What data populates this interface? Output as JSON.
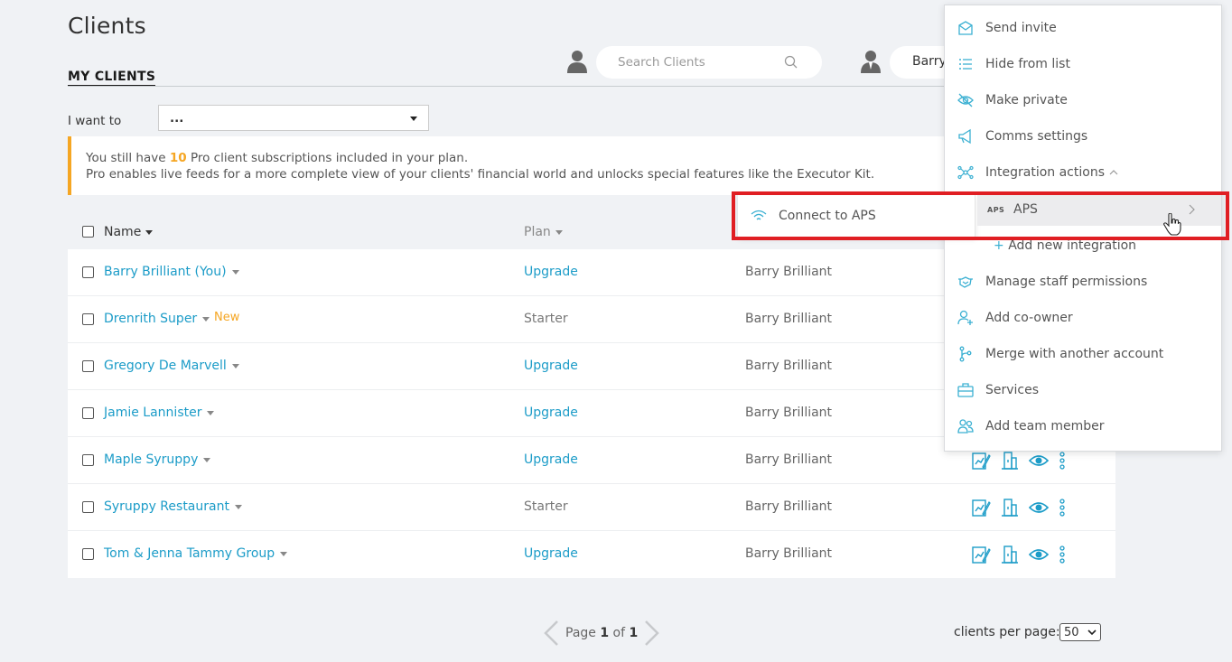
{
  "page": {
    "title": "Clients",
    "tab_active": "MY CLIENTS"
  },
  "search": {
    "placeholder": "Search Clients"
  },
  "user": {
    "name": "Barry"
  },
  "iwant": {
    "label": "I want to",
    "value": "..."
  },
  "banner": {
    "line1_prefix": "You still have ",
    "count": "10",
    "line1_suffix": " Pro client subscriptions included in your plan.",
    "line2": "Pro enables live feeds for a more complete view of your clients' financial world and unlocks special features like the Executor Kit."
  },
  "table": {
    "headers": {
      "name": "Name",
      "plan": "Plan"
    },
    "rows": [
      {
        "name": "Barry Brilliant (You)",
        "tag": "",
        "plan": "Upgrade",
        "plan_type": "upgrade",
        "owner": "Barry Brilliant"
      },
      {
        "name": "Drenrith Super",
        "tag": "New",
        "plan": "Starter",
        "plan_type": "starter",
        "owner": "Barry Brilliant"
      },
      {
        "name": "Gregory De Marvell",
        "tag": "",
        "plan": "Upgrade",
        "plan_type": "upgrade",
        "owner": "Barry Brilliant"
      },
      {
        "name": "Jamie Lannister",
        "tag": "",
        "plan": "Upgrade",
        "plan_type": "upgrade",
        "owner": "Barry Brilliant"
      },
      {
        "name": "Maple Syruppy",
        "tag": "",
        "plan": "Upgrade",
        "plan_type": "upgrade",
        "owner": "Barry Brilliant"
      },
      {
        "name": "Syruppy Restaurant",
        "tag": "",
        "plan": "Starter",
        "plan_type": "starter",
        "owner": "Barry Brilliant"
      },
      {
        "name": "Tom & Jenna Tammy Group",
        "tag": "",
        "plan": "Upgrade",
        "plan_type": "upgrade",
        "owner": "Barry Brilliant"
      }
    ]
  },
  "pagination": {
    "label_prefix": "Page ",
    "current": "1",
    "sep": " of ",
    "total": "1"
  },
  "per_page": {
    "label": "clients per page:",
    "value": "50"
  },
  "menu": {
    "items": [
      {
        "label": "Send invite",
        "icon": "envelope-icon"
      },
      {
        "label": "Hide from list",
        "icon": "list-icon"
      },
      {
        "label": "Make private",
        "icon": "eye-slash-icon"
      },
      {
        "label": "Comms settings",
        "icon": "megaphone-icon"
      },
      {
        "label": "Integration actions",
        "icon": "network-icon"
      },
      {
        "label": "Manage staff permissions",
        "icon": "handshake-icon"
      },
      {
        "label": "Add co-owner",
        "icon": "user-plus-icon"
      },
      {
        "label": "Merge with another account",
        "icon": "merge-icon"
      },
      {
        "label": "Services",
        "icon": "briefcase-icon"
      },
      {
        "label": "Add team member",
        "icon": "users-icon"
      }
    ],
    "submenu_left": "Connect to APS",
    "submenu_right_tag": "APS",
    "submenu_right_label": "APS",
    "add_integration": "Add new integration"
  },
  "colors": {
    "accent": "#1c9cc8",
    "warning": "#f5a623",
    "highlight": "#e01e23",
    "background": "#f0f2f5"
  }
}
